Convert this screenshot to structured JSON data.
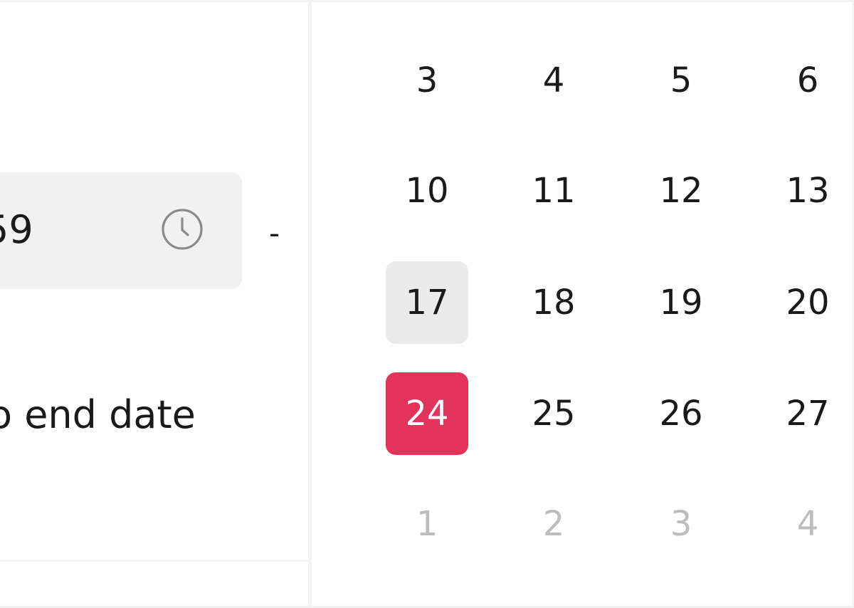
{
  "schedule": {
    "start_time_value": "59",
    "range_separator": "-",
    "no_end_date_label": "o end date",
    "time_icon": "clock-icon"
  },
  "calendar": {
    "today": "17",
    "selected": "24",
    "accent_color": "#e2335a",
    "rows": [
      [
        {
          "day": "3"
        },
        {
          "day": "4"
        },
        {
          "day": "5"
        },
        {
          "day": "6"
        }
      ],
      [
        {
          "day": "10"
        },
        {
          "day": "11"
        },
        {
          "day": "12"
        },
        {
          "day": "13"
        }
      ],
      [
        {
          "day": "17",
          "state": "today"
        },
        {
          "day": "18"
        },
        {
          "day": "19"
        },
        {
          "day": "20"
        }
      ],
      [
        {
          "day": "24",
          "state": "selected"
        },
        {
          "day": "25"
        },
        {
          "day": "26"
        },
        {
          "day": "27"
        }
      ],
      [
        {
          "day": "1",
          "state": "muted"
        },
        {
          "day": "2",
          "state": "muted"
        },
        {
          "day": "3",
          "state": "muted"
        },
        {
          "day": "4",
          "state": "muted"
        }
      ]
    ]
  }
}
